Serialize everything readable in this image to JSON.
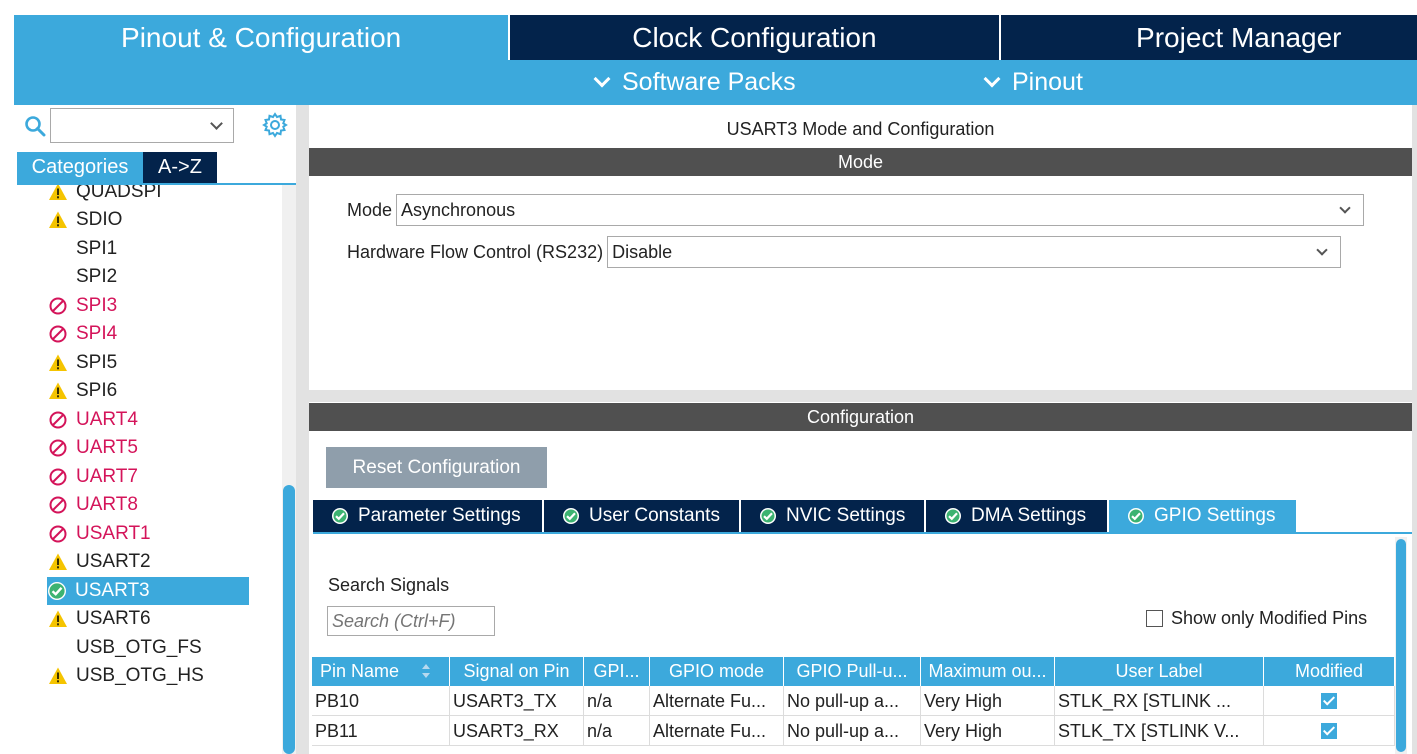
{
  "top_tabs": [
    {
      "label": "Pinout & Configuration",
      "active": true
    },
    {
      "label": "Clock Configuration",
      "active": false
    },
    {
      "label": "Project Manager",
      "active": false
    }
  ],
  "subbar": {
    "software_packs": "Software Packs",
    "pinout": "Pinout"
  },
  "left": {
    "search_value": "",
    "category_tabs": [
      "Categories",
      "A->Z"
    ],
    "items": [
      {
        "label": "QUADSPI",
        "status": "warning"
      },
      {
        "label": "SDIO",
        "status": "warning"
      },
      {
        "label": "SPI1",
        "status": "none"
      },
      {
        "label": "SPI2",
        "status": "none"
      },
      {
        "label": "SPI3",
        "status": "error"
      },
      {
        "label": "SPI4",
        "status": "error"
      },
      {
        "label": "SPI5",
        "status": "warning"
      },
      {
        "label": "SPI6",
        "status": "warning"
      },
      {
        "label": "UART4",
        "status": "error"
      },
      {
        "label": "UART5",
        "status": "error"
      },
      {
        "label": "UART7",
        "status": "error"
      },
      {
        "label": "UART8",
        "status": "error"
      },
      {
        "label": "USART1",
        "status": "error"
      },
      {
        "label": "USART2",
        "status": "warning"
      },
      {
        "label": "USART3",
        "status": "ok",
        "selected": true
      },
      {
        "label": "USART6",
        "status": "warning"
      },
      {
        "label": "USB_OTG_FS",
        "status": "none"
      },
      {
        "label": "USB_OTG_HS",
        "status": "warning"
      }
    ]
  },
  "panel": {
    "title": "USART3 Mode and Configuration",
    "mode_header": "Mode",
    "mode_label": "Mode",
    "mode_value": "Asynchronous",
    "flow_label": "Hardware Flow Control (RS232)",
    "flow_value": "Disable",
    "config_header": "Configuration",
    "reset_button": "Reset Configuration",
    "config_tabs": [
      {
        "label": "Parameter Settings",
        "active": false
      },
      {
        "label": "User Constants",
        "active": false
      },
      {
        "label": "NVIC Settings",
        "active": false
      },
      {
        "label": "DMA Settings",
        "active": false
      },
      {
        "label": "GPIO Settings",
        "active": true
      }
    ],
    "search_signals_label": "Search Signals",
    "search_placeholder": "Search (Ctrl+F)",
    "show_modified_label": "Show only Modified Pins",
    "show_modified_checked": false
  },
  "gpio_table": {
    "columns": [
      "Pin Name",
      "Signal on Pin",
      "GPI...",
      "GPIO mode",
      "GPIO Pull-u...",
      "Maximum ou...",
      "User Label",
      "Modified"
    ],
    "rows": [
      [
        "PB10",
        "USART3_TX",
        "n/a",
        "Alternate Fu...",
        "No pull-up a...",
        "Very High",
        "STLK_RX [STLINK ...",
        true
      ],
      [
        "PB11",
        "USART3_RX",
        "n/a",
        "Alternate Fu...",
        "No pull-up a...",
        "Very High",
        "STLK_TX [STLINK V...",
        true
      ]
    ]
  },
  "colors": {
    "accent": "#3ca9dc",
    "navy": "#03234b",
    "header_gray": "#505050",
    "warning": "#f5c400",
    "error": "#d4145a",
    "ok": "#3cb371"
  }
}
